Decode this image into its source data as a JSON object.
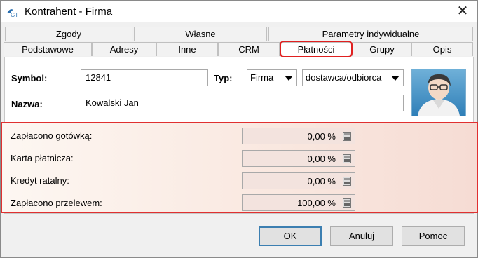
{
  "window": {
    "title": "Kontrahent - Firma"
  },
  "tabs_row1": [
    "Zgody",
    "Własne",
    "Parametry indywidualne"
  ],
  "tabs_row2": [
    "Podstawowe",
    "Adresy",
    "Inne",
    "CRM",
    "Płatności",
    "Grupy",
    "Opis"
  ],
  "active_tab": "Płatności",
  "form": {
    "symbol_label": "Symbol:",
    "symbol_value": "12841",
    "typ_label": "Typ:",
    "typ_value": "Firma",
    "role_value": "dostawca/odbiorca",
    "nazwa_label": "Nazwa:",
    "nazwa_value": "Kowalski Jan"
  },
  "payments": [
    {
      "label": "Zapłacono gotówką:",
      "value": "0,00 %"
    },
    {
      "label": "Karta płatnicza:",
      "value": "0,00 %"
    },
    {
      "label": "Kredyt ratalny:",
      "value": "0,00 %"
    },
    {
      "label": "Zapłacono przelewem:",
      "value": "100,00 %"
    }
  ],
  "buttons": {
    "ok": "OK",
    "cancel": "Anuluj",
    "help": "Pomoc"
  },
  "colors": {
    "highlight": "#e03030",
    "accent": "#3c7fb1"
  },
  "icons": {
    "app": "app-logo-icon",
    "close": "close-icon",
    "avatar": "person-avatar-icon",
    "calc": "calculator-icon"
  }
}
